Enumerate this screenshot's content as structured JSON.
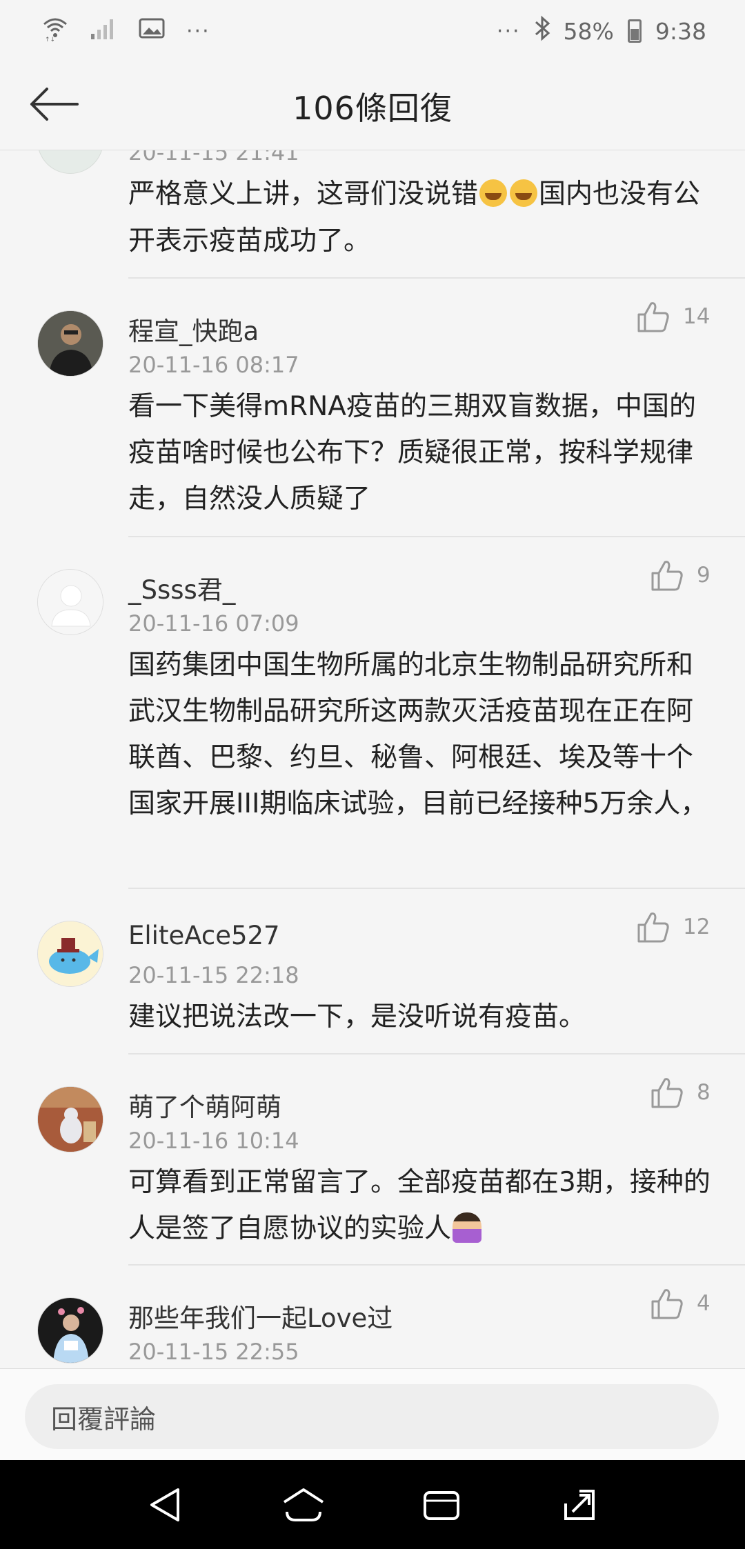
{
  "status_bar": {
    "left_dots": "···",
    "right_dots": "···",
    "battery": "58%",
    "time": "9:38"
  },
  "header": {
    "title": "106條回復"
  },
  "partial_comment": {
    "time": "20-11-15 21:41",
    "text_before": "严格意义上讲，这哥们没说错",
    "text_after": "国内也没有公开表示疫苗成功了。"
  },
  "comments": [
    {
      "username": "程宣_快跑a",
      "time": "20-11-16 08:17",
      "likes": "14",
      "text": "看一下美得mRNA疫苗的三期双盲数据，中国的疫苗啥时候也公布下？质疑很正常，按科学规律走，自然没人质疑了"
    },
    {
      "username": "_Ssss君_",
      "time": "20-11-16 07:09",
      "likes": "9",
      "text": "国药集团中国生物所属的北京生物制品研究所和武汉生物制品研究所这两款灭活疫苗现在正在阿联酋、巴黎、约旦、秘鲁、阿根廷、埃及等十个国家开展III期临床试验，目前已经接种5万余人，"
    },
    {
      "username": "EliteAce527",
      "time": "20-11-15 22:18",
      "likes": "12",
      "text": "建议把说法改一下，是没听说有疫苗。"
    },
    {
      "username": "萌了个萌阿萌",
      "time": "20-11-16 10:14",
      "likes": "8",
      "text": "可算看到正常留言了。全部疫苗都在3期，接种的人是签了自愿协议的实验人"
    },
    {
      "username": "那些年我们一起Love过",
      "time": "20-11-15 22:55",
      "likes": "4",
      "text": ""
    }
  ],
  "reply_input": {
    "placeholder": "回覆評論"
  },
  "icons": {
    "wifi": "wifi-icon",
    "signal": "signal-icon",
    "gallery": "image-icon",
    "bluetooth": "bluetooth-icon",
    "battery": "battery-icon",
    "back": "arrow-left-icon",
    "like": "thumbs-up-icon",
    "nav_back": "triangle-back-icon",
    "nav_home": "home-icon",
    "nav_recent": "recent-apps-icon",
    "nav_expand": "expand-icon"
  }
}
